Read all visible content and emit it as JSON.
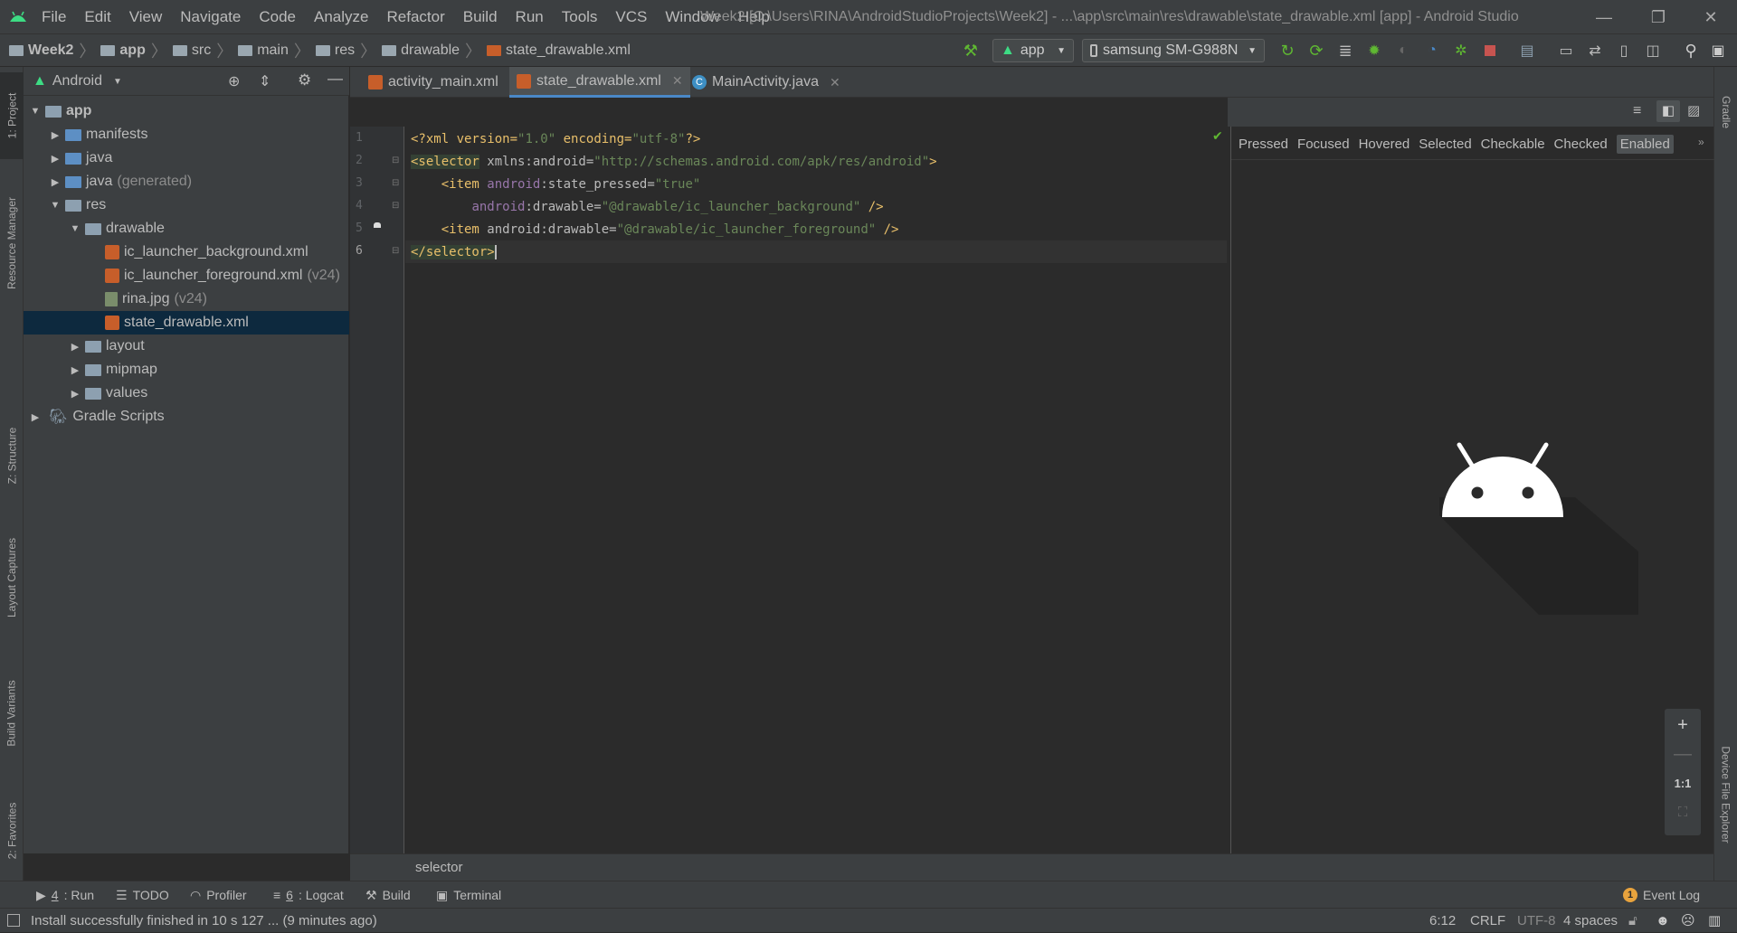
{
  "window": {
    "title": "Week2 [C:\\Users\\RINA\\AndroidStudioProjects\\Week2] - ...\\app\\src\\main\\res\\drawable\\state_drawable.xml [app] - Android Studio",
    "menu": [
      "File",
      "Edit",
      "View",
      "Navigate",
      "Code",
      "Analyze",
      "Refactor",
      "Build",
      "Run",
      "Tools",
      "VCS",
      "Window",
      "Help"
    ]
  },
  "breadcrumbs": [
    "Week2",
    "app",
    "src",
    "main",
    "res",
    "drawable",
    "state_drawable.xml"
  ],
  "toolbar": {
    "run_config": "app",
    "device": "samsung SM-G988N"
  },
  "left_tool_tabs": [
    "1: Project",
    "Resource Manager",
    "Z: Structure",
    "Layout Captures",
    "Build Variants",
    "2: Favorites"
  ],
  "right_tool_tabs": [
    "Gradle",
    "Device File Explorer"
  ],
  "project": {
    "view_mode": "Android",
    "tree": [
      {
        "label": "app",
        "dim": "",
        "depth": 0,
        "arrow": "open",
        "icon": "folder-module-icon"
      },
      {
        "label": "manifests",
        "dim": "",
        "depth": 1,
        "arrow": "closed",
        "icon": "folder-icon"
      },
      {
        "label": "java",
        "dim": "",
        "depth": 1,
        "arrow": "closed",
        "icon": "folder-icon"
      },
      {
        "label": "java",
        "dim": "(generated)",
        "depth": 1,
        "arrow": "closed",
        "icon": "folder-generated-icon"
      },
      {
        "label": "res",
        "dim": "",
        "depth": 1,
        "arrow": "open",
        "icon": "folder-res-icon"
      },
      {
        "label": "drawable",
        "dim": "",
        "depth": 2,
        "arrow": "open",
        "icon": "folder-icon"
      },
      {
        "label": "ic_launcher_background.xml",
        "dim": "",
        "depth": 3,
        "arrow": "none",
        "icon": "xml-file-icon"
      },
      {
        "label": "ic_launcher_foreground.xml",
        "dim": "(v24)",
        "depth": 3,
        "arrow": "none",
        "icon": "xml-file-icon"
      },
      {
        "label": "rina.jpg",
        "dim": "(v24)",
        "depth": 3,
        "arrow": "none",
        "icon": "image-file-icon"
      },
      {
        "label": "state_drawable.xml",
        "dim": "",
        "depth": 3,
        "arrow": "none",
        "icon": "xml-file-icon",
        "selected": true
      },
      {
        "label": "layout",
        "dim": "",
        "depth": 2,
        "arrow": "closed",
        "icon": "folder-icon"
      },
      {
        "label": "mipmap",
        "dim": "",
        "depth": 2,
        "arrow": "closed",
        "icon": "folder-icon"
      },
      {
        "label": "values",
        "dim": "",
        "depth": 2,
        "arrow": "closed",
        "icon": "folder-icon"
      },
      {
        "label": "Gradle Scripts",
        "dim": "",
        "depth": 0,
        "arrow": "closed",
        "icon": "gradle-icon"
      }
    ]
  },
  "editor_tabs": [
    {
      "label": "activity_main.xml",
      "active": false
    },
    {
      "label": "state_drawable.xml",
      "active": true
    },
    {
      "label": "MainActivity.java",
      "active": false
    }
  ],
  "code": {
    "line_numbers": [
      "1",
      "2",
      "3",
      "4",
      "5",
      "6"
    ],
    "line1": {
      "a": "<?xml version=",
      "b": "\"1.0\"",
      "c": " encoding=",
      "d": "\"utf-8\"",
      "e": "?>"
    },
    "line2": {
      "a": "<selector",
      "b": " xmlns:android=",
      "c": "\"http://schemas.android.com/apk/res/android\"",
      "d": ">"
    },
    "line3": {
      "a": "    <item ",
      "b": "android",
      "c": ":state_pressed=",
      "d": "\"true\""
    },
    "line4": {
      "a": "        ",
      "b": "android",
      "c": ":drawable=",
      "d": "\"@drawable/ic_launcher_background\"",
      "e": " />"
    },
    "line5": {
      "a": "    <item ",
      "b": "android",
      "c": ":drawable=",
      "d": "\"@drawable/ic_launcher_foreground\"",
      "e": " />"
    },
    "line6": {
      "a": "</selector>"
    }
  },
  "preview": {
    "states": [
      "Pressed",
      "Focused",
      "Hovered",
      "Selected",
      "Checkable",
      "Checked",
      "Enabled"
    ],
    "enabled_state": "Enabled",
    "zoom": {
      "plus": "+",
      "minus": "—",
      "one_to_one": "1:1"
    }
  },
  "editor_breadcrumb": "selector",
  "bottom_tabs": [
    {
      "num": "4",
      "label": ": Run"
    },
    {
      "num": "",
      "label": "TODO"
    },
    {
      "num": "",
      "label": "Profiler"
    },
    {
      "num": "6",
      "label": ": Logcat"
    },
    {
      "num": "",
      "label": "Build"
    },
    {
      "num": "",
      "label": "Terminal"
    }
  ],
  "event_log": {
    "count": "1",
    "label": "Event Log"
  },
  "status": {
    "message": "Install successfully finished in 10 s 127 ... (9 minutes ago)",
    "position": "6:12",
    "line_sep": "CRLF",
    "encoding": "UTF-8",
    "indent": "4 spaces"
  },
  "colors": {
    "accent": "#4a88c7",
    "android_green": "#3ddc84",
    "selection": "#0d293e"
  }
}
